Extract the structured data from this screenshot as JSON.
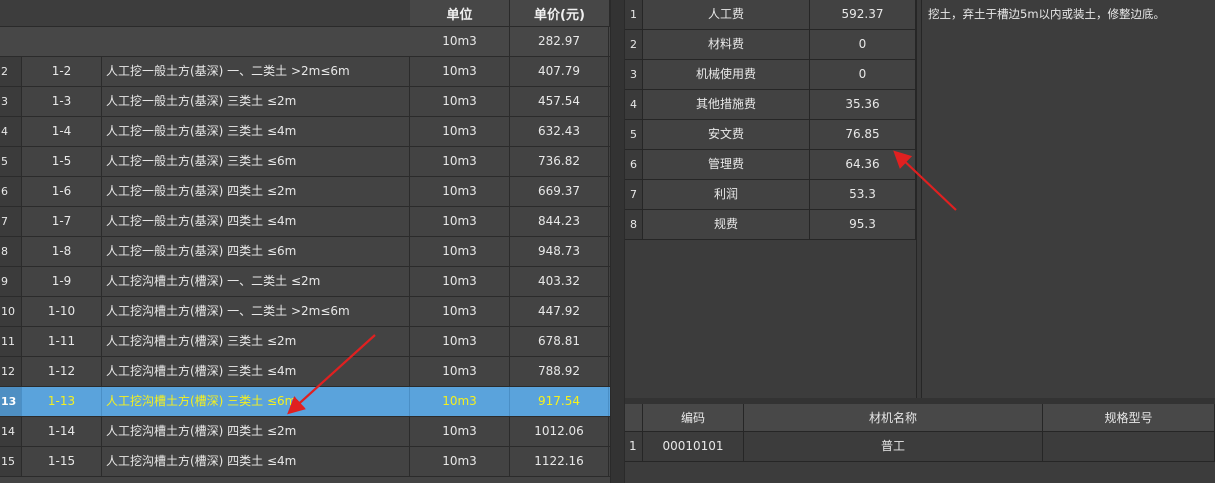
{
  "left_table": {
    "headers": {
      "unit": "单位",
      "price": "单价(元)"
    },
    "rows": [
      {
        "idx": "",
        "code": "",
        "name": "",
        "unit": "10m3",
        "price": "282.97"
      },
      {
        "idx": "2",
        "code": "1-2",
        "name": "人工挖一般土方(基深) 一、二类土 >2m≤6m",
        "unit": "10m3",
        "price": "407.79"
      },
      {
        "idx": "3",
        "code": "1-3",
        "name": "人工挖一般土方(基深) 三类土 ≤2m",
        "unit": "10m3",
        "price": "457.54"
      },
      {
        "idx": "4",
        "code": "1-4",
        "name": "人工挖一般土方(基深) 三类土 ≤4m",
        "unit": "10m3",
        "price": "632.43"
      },
      {
        "idx": "5",
        "code": "1-5",
        "name": "人工挖一般土方(基深) 三类土 ≤6m",
        "unit": "10m3",
        "price": "736.82"
      },
      {
        "idx": "6",
        "code": "1-6",
        "name": "人工挖一般土方(基深) 四类土 ≤2m",
        "unit": "10m3",
        "price": "669.37"
      },
      {
        "idx": "7",
        "code": "1-7",
        "name": "人工挖一般土方(基深) 四类土 ≤4m",
        "unit": "10m3",
        "price": "844.23"
      },
      {
        "idx": "8",
        "code": "1-8",
        "name": "人工挖一般土方(基深) 四类土 ≤6m",
        "unit": "10m3",
        "price": "948.73"
      },
      {
        "idx": "9",
        "code": "1-9",
        "name": "人工挖沟槽土方(槽深) 一、二类土 ≤2m",
        "unit": "10m3",
        "price": "403.32"
      },
      {
        "idx": "10",
        "code": "1-10",
        "name": "人工挖沟槽土方(槽深) 一、二类土 >2m≤6m",
        "unit": "10m3",
        "price": "447.92"
      },
      {
        "idx": "11",
        "code": "1-11",
        "name": "人工挖沟槽土方(槽深) 三类土 ≤2m",
        "unit": "10m3",
        "price": "678.81"
      },
      {
        "idx": "12",
        "code": "1-12",
        "name": "人工挖沟槽土方(槽深) 三类土 ≤4m",
        "unit": "10m3",
        "price": "788.92"
      },
      {
        "idx": "13",
        "code": "1-13",
        "name": "人工挖沟槽土方(槽深) 三类土 ≤6m",
        "unit": "10m3",
        "price": "917.54",
        "selected": true
      },
      {
        "idx": "14",
        "code": "1-14",
        "name": "人工挖沟槽土方(槽深) 四类土 ≤2m",
        "unit": "10m3",
        "price": "1012.06"
      },
      {
        "idx": "15",
        "code": "1-15",
        "name": "人工挖沟槽土方(槽深) 四类土 ≤4m",
        "unit": "10m3",
        "price": "1122.16"
      }
    ]
  },
  "fee_table": {
    "rows": [
      {
        "idx": "1",
        "name": "人工费",
        "value": "592.37"
      },
      {
        "idx": "2",
        "name": "材料费",
        "value": "0"
      },
      {
        "idx": "3",
        "name": "机械使用费",
        "value": "0"
      },
      {
        "idx": "4",
        "name": "其他措施费",
        "value": "35.36"
      },
      {
        "idx": "5",
        "name": "安文费",
        "value": "76.85"
      },
      {
        "idx": "6",
        "name": "管理费",
        "value": "64.36"
      },
      {
        "idx": "7",
        "name": "利润",
        "value": "53.3"
      },
      {
        "idx": "8",
        "name": "规费",
        "value": "95.3"
      }
    ]
  },
  "description": "挖土，弃土于槽边5m以内或装土，修整边底。",
  "material_table": {
    "headers": {
      "code": "编码",
      "name": "材机名称",
      "spec": "规格型号"
    },
    "rows": [
      {
        "idx": "1",
        "code": "00010101",
        "name": "普工",
        "spec": ""
      }
    ]
  },
  "colors": {
    "selected_row": "#5aa3dc",
    "selected_text": "#f5f01e",
    "annotation_arrow": "#e02020"
  },
  "icons": [
    "red-arrow-annotation"
  ]
}
